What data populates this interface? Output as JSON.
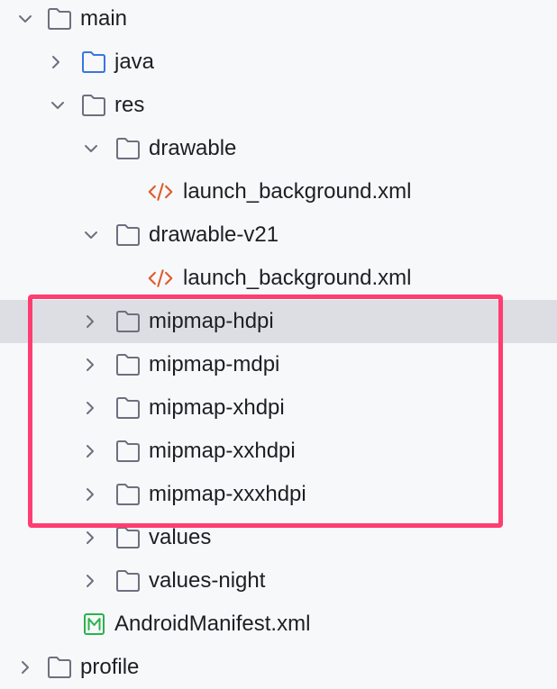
{
  "tree": {
    "main": {
      "label": "main",
      "icon": "folder-icon",
      "state": "expanded"
    },
    "java": {
      "label": "java",
      "icon": "source-folder-icon",
      "state": "collapsed"
    },
    "res": {
      "label": "res",
      "icon": "folder-icon",
      "state": "expanded"
    },
    "drawable": {
      "label": "drawable",
      "icon": "folder-icon",
      "state": "expanded"
    },
    "drawable_launch": {
      "label": "launch_background.xml",
      "icon": "xml-file-icon"
    },
    "drawable_v21": {
      "label": "drawable-v21",
      "icon": "folder-icon",
      "state": "expanded"
    },
    "drawable_v21_launch": {
      "label": "launch_background.xml",
      "icon": "xml-file-icon"
    },
    "mipmap_hdpi": {
      "label": "mipmap-hdpi",
      "icon": "folder-icon",
      "state": "collapsed",
      "selected": true
    },
    "mipmap_mdpi": {
      "label": "mipmap-mdpi",
      "icon": "folder-icon",
      "state": "collapsed"
    },
    "mipmap_xhdpi": {
      "label": "mipmap-xhdpi",
      "icon": "folder-icon",
      "state": "collapsed"
    },
    "mipmap_xxhdpi": {
      "label": "mipmap-xxhdpi",
      "icon": "folder-icon",
      "state": "collapsed"
    },
    "mipmap_xxxhdpi": {
      "label": "mipmap-xxxhdpi",
      "icon": "folder-icon",
      "state": "collapsed"
    },
    "values": {
      "label": "values",
      "icon": "folder-icon",
      "state": "collapsed"
    },
    "values_night": {
      "label": "values-night",
      "icon": "folder-icon",
      "state": "collapsed"
    },
    "manifest": {
      "label": "AndroidManifest.xml",
      "icon": "manifest-file-icon"
    },
    "profile": {
      "label": "profile",
      "icon": "folder-icon",
      "state": "collapsed"
    }
  },
  "colors": {
    "background": "#f7f8fa",
    "selected_row": "#dcdee3",
    "highlight_border": "#ff3d71",
    "xml_icon": "#e0592b",
    "source_folder_icon": "#3a75e0",
    "manifest_icon": "#28b34b"
  }
}
